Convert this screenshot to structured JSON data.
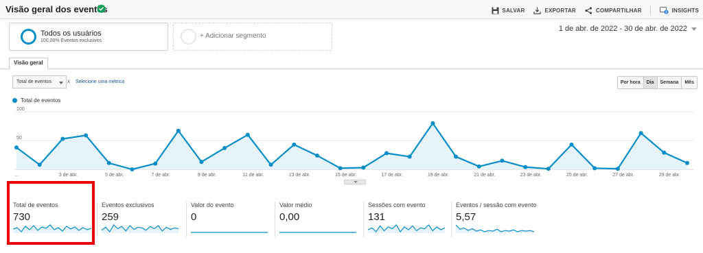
{
  "header": {
    "title": "Visão geral dos eventos",
    "actions": [
      {
        "label": "SALVAR",
        "icon": "save-icon"
      },
      {
        "label": "EXPORTAR",
        "icon": "export-icon"
      },
      {
        "label": "COMPARTILHAR",
        "icon": "share-icon"
      },
      {
        "label": "INSIGHTS",
        "icon": "insights-icon"
      }
    ]
  },
  "segments": {
    "active_name": "Todos os usuários",
    "active_sub": "100,00% Eventos exclusivos",
    "add_label": "+ Adicionar segmento"
  },
  "date_range": "1 de abr. de 2022 - 30 de abr. de 2022",
  "tab": "Visão geral",
  "controls": {
    "metric_select": "Total de eventos",
    "remove_symbol": "x",
    "select_metric_link": "Selecione uma métrica",
    "granularity": [
      "Por hora",
      "Dia",
      "Semana",
      "Mês"
    ],
    "granularity_active": "Dia"
  },
  "colors": {
    "series": "#058dc7",
    "area_fill": "#e6f3f9",
    "highlight": "#ee0000"
  },
  "chart_data": {
    "type": "area",
    "legend": "Total de eventos",
    "yticks": [
      100,
      50
    ],
    "ylim": [
      0,
      100
    ],
    "x": [
      "1 de abr.",
      "2 de abr.",
      "3 de abr.",
      "4 de abr.",
      "5 de abr.",
      "6 de abr.",
      "7 de abr.",
      "8 de abr.",
      "9 de abr.",
      "10 de abr.",
      "11 de abr.",
      "12 de abr.",
      "13 de abr.",
      "14 de abr.",
      "15 de abr.",
      "16 de abr.",
      "17 de abr.",
      "18 de abr.",
      "19 de abr.",
      "20 de abr.",
      "21 de abr.",
      "22 de abr.",
      "23 de abr.",
      "24 de abr.",
      "25 de abr.",
      "26 de abr.",
      "27 de abr.",
      "28 de abr.",
      "29 de abr.",
      "30 de abr."
    ],
    "xtick_labels": [
      "...",
      "3 de abr.",
      "5 de abr.",
      "7 de abr.",
      "9 de abr.",
      "11 de abr.",
      "13 de abr.",
      "15 de abr.",
      "17 de abr.",
      "19 de abr.",
      "21 de abr.",
      "23 de abr.",
      "25 de abr.",
      "27 de abr.",
      "29 de abr."
    ],
    "values": [
      38,
      8,
      53,
      59,
      11,
      0,
      10,
      67,
      13,
      37,
      60,
      8,
      43,
      24,
      2,
      3,
      28,
      22,
      80,
      22,
      5,
      15,
      4,
      1,
      43,
      2,
      1,
      63,
      29,
      11
    ]
  },
  "scorecards": [
    {
      "label": "Total de eventos",
      "value": "730",
      "spark": [
        10,
        12,
        6,
        14,
        9,
        15,
        8,
        13,
        11,
        16,
        9,
        12,
        7,
        14,
        10,
        13,
        8,
        12,
        9,
        11
      ]
    },
    {
      "label": "Eventos exclusivos",
      "value": "259",
      "spark": [
        8,
        12,
        6,
        15,
        10,
        13,
        7,
        14,
        9,
        12,
        11,
        8,
        13,
        10,
        14,
        7,
        12,
        9,
        11,
        10
      ]
    },
    {
      "label": "Valor do evento",
      "value": "0",
      "spark": [
        0,
        0,
        0,
        0,
        0,
        0,
        0,
        0,
        0,
        0,
        0,
        0,
        0,
        0,
        0,
        0,
        0,
        0,
        0,
        0
      ]
    },
    {
      "label": "Valor médio",
      "value": "0,00",
      "spark": [
        0,
        0,
        0,
        0,
        0,
        0,
        0,
        0,
        0,
        0,
        0,
        0,
        0,
        0,
        0,
        0,
        0,
        0,
        0,
        0
      ]
    },
    {
      "label": "Sessões com evento",
      "value": "131",
      "spark": [
        9,
        11,
        7,
        13,
        8,
        12,
        10,
        14,
        7,
        12,
        9,
        13,
        8,
        11,
        10,
        14,
        8,
        12,
        9,
        11
      ]
    },
    {
      "label": "Eventos / sessão com evento",
      "value": "5,57",
      "spark": [
        15,
        8,
        10,
        6,
        9,
        5,
        7,
        4,
        6,
        5,
        8,
        4,
        6,
        5,
        7,
        4,
        6,
        5,
        6,
        4
      ]
    }
  ]
}
